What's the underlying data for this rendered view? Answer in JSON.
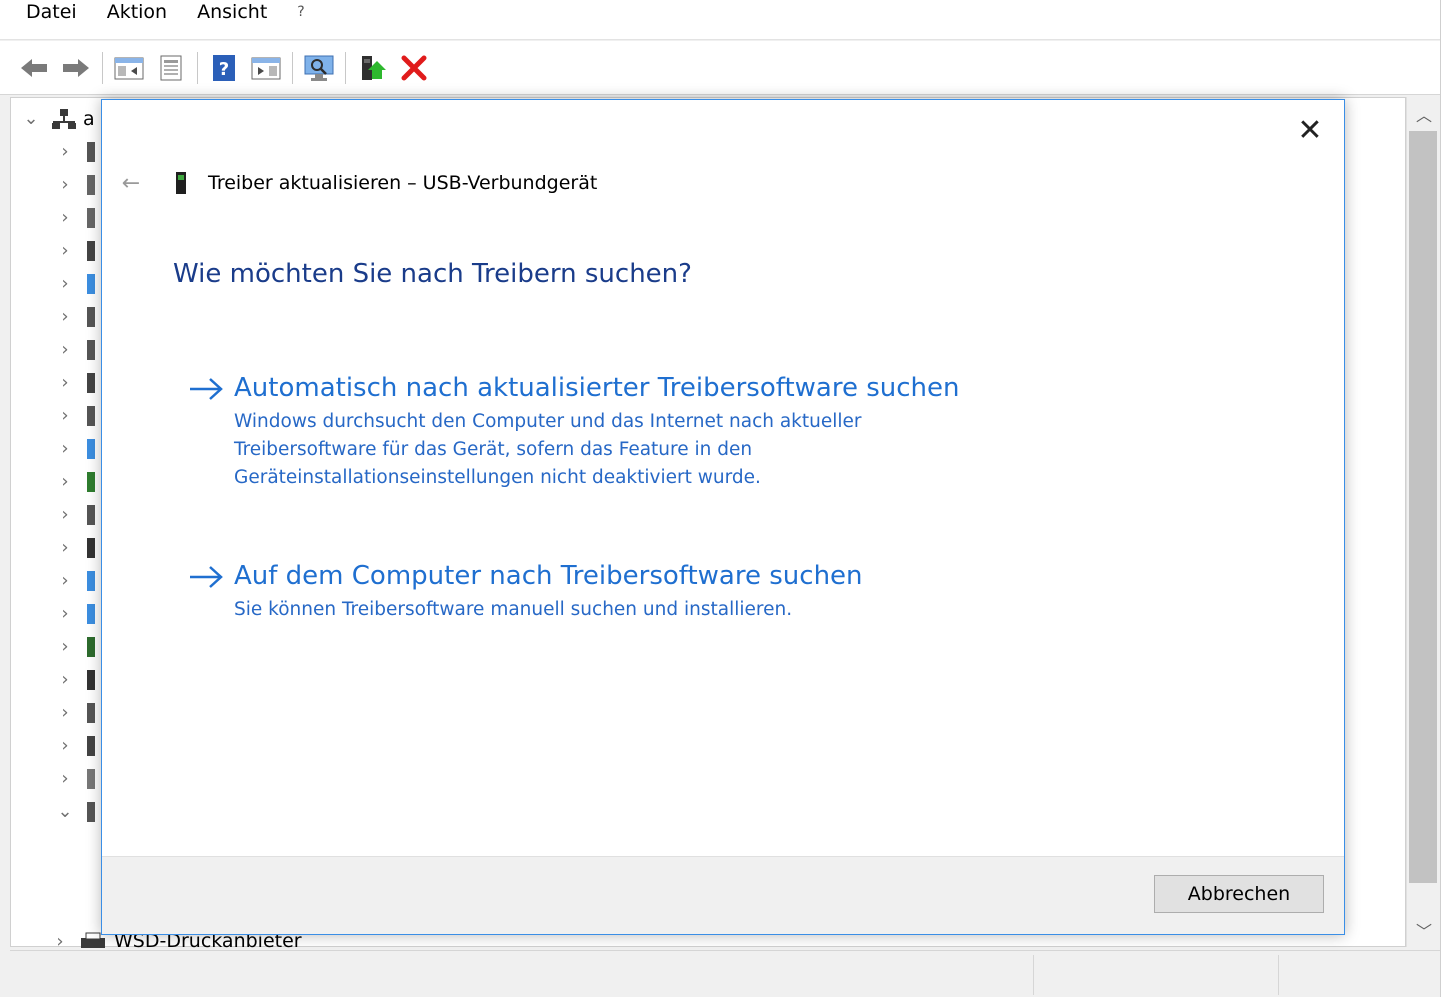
{
  "menu": {
    "items": [
      "Datei",
      "Aktion",
      "Ansicht",
      "?"
    ]
  },
  "toolbar": {
    "icons": [
      "back-icon",
      "forward-icon",
      "console-tree-icon",
      "properties-icon",
      "help-icon",
      "view-icon",
      "scan-hardware-icon",
      "update-driver-icon",
      "uninstall-icon"
    ]
  },
  "tree": {
    "root_label_partial": "a",
    "last_visible_item": "WSD-Druckanbieter"
  },
  "dialog": {
    "title": "Treiber aktualisieren – USB-Verbundgerät",
    "heading": "Wie möchten Sie nach Treibern suchen?",
    "option1": {
      "title": "Automatisch nach aktualisierter Treibersoftware suchen",
      "description": "Windows durchsucht den Computer und das Internet nach aktueller Treibersoftware für das Gerät, sofern das Feature in den Geräteinstallationseinstellungen nicht deaktiviert wurde."
    },
    "option2": {
      "title": "Auf dem Computer nach Treibersoftware suchen",
      "description": "Sie können Treibersoftware manuell suchen und installieren."
    },
    "cancel_label": "Abbrechen",
    "close_glyph": "✕",
    "back_glyph": "←"
  },
  "colors": {
    "accent": "#1f6fd0",
    "heading": "#1a3c8a",
    "dialog_border": "#3a8ee6"
  }
}
